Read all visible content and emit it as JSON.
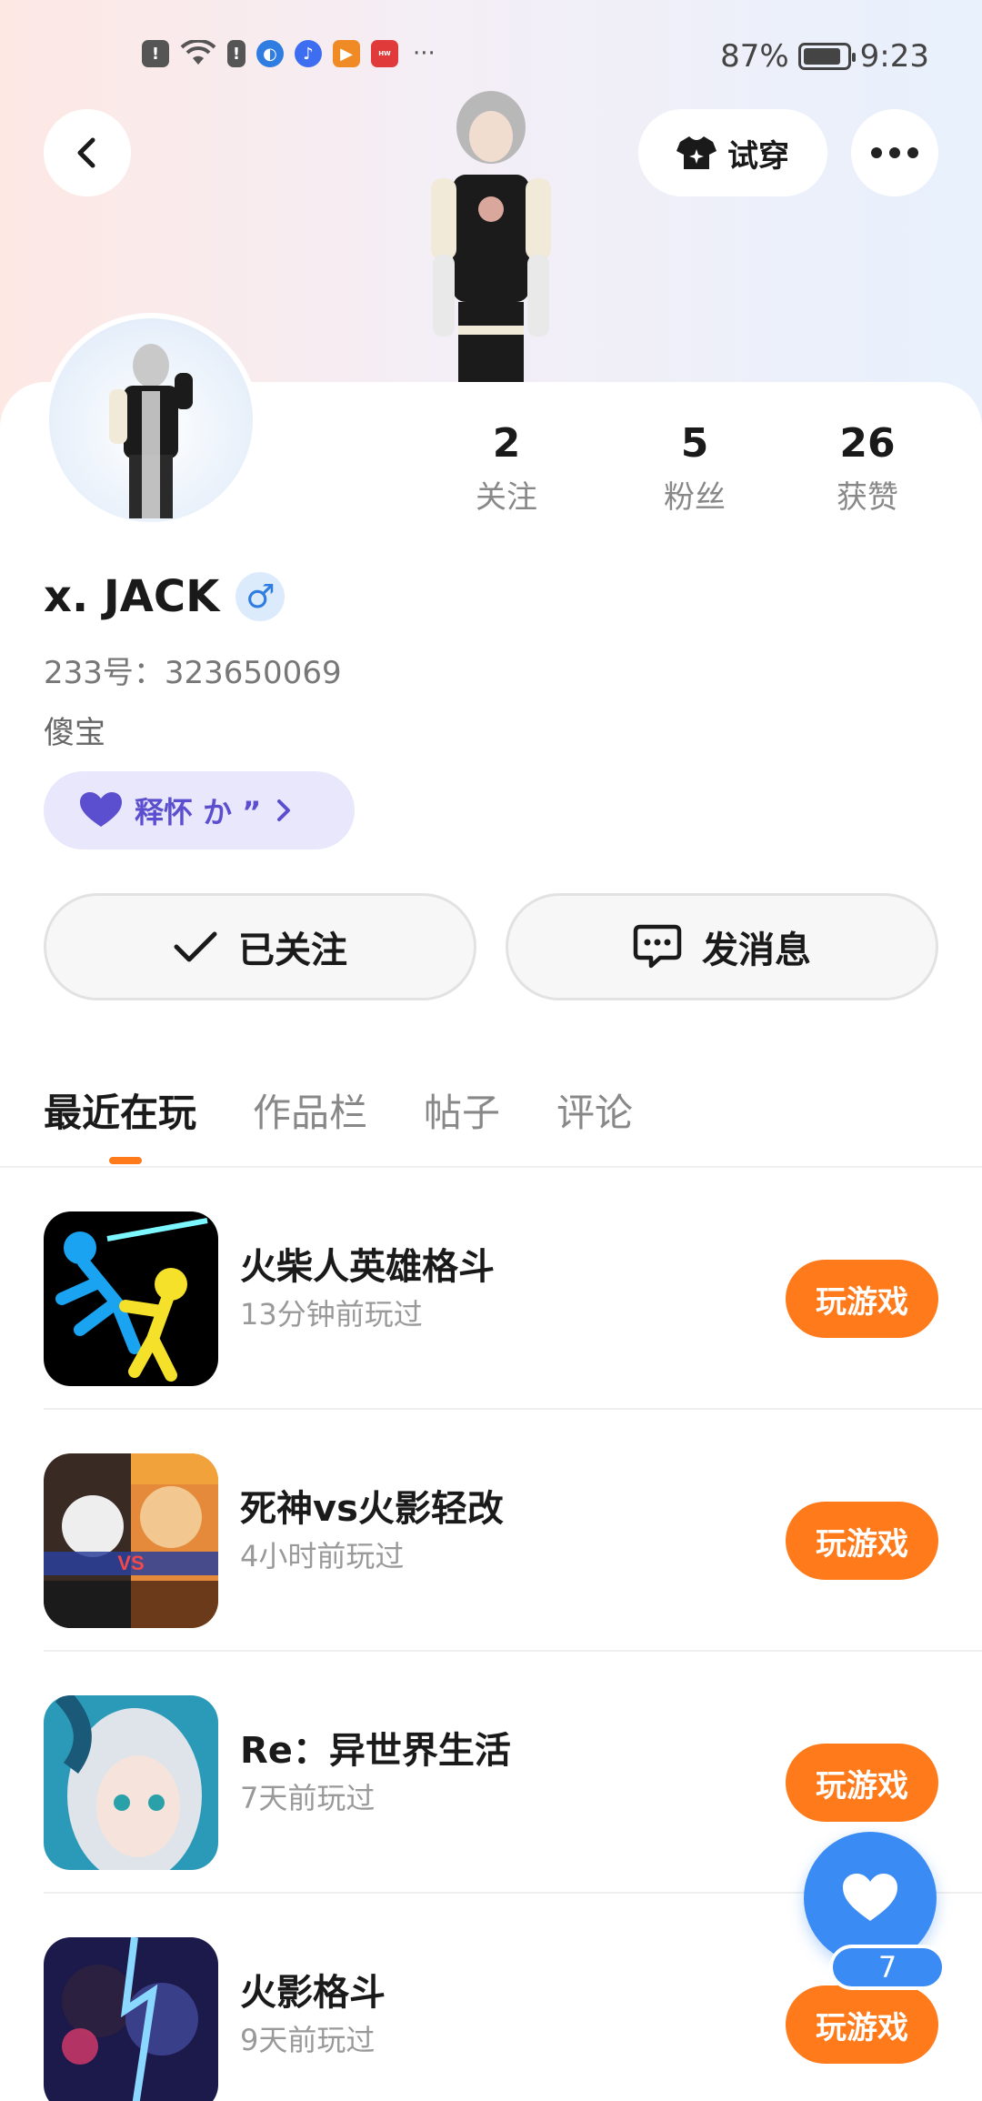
{
  "status_bar": {
    "battery_percent": "87%",
    "battery_level": 0.87,
    "time": "9:23",
    "overflow": "···",
    "notification_icons": [
      "alert-icon",
      "wifi-icon",
      "sim-alert-icon",
      "browser-icon",
      "music-icon",
      "video-icon",
      "huawei-icon"
    ]
  },
  "header": {
    "try_on_label": "试穿"
  },
  "profile": {
    "stats": [
      {
        "value": "2",
        "label": "关注"
      },
      {
        "value": "5",
        "label": "粉丝"
      },
      {
        "value": "26",
        "label": "获赞"
      }
    ],
    "username": "x. JACK",
    "gender_symbol": "♂",
    "user_id": "233号：323650069",
    "bio": "傻宝",
    "fan_tag": "释怀 か ”"
  },
  "actions": {
    "follow_label": "已关注",
    "message_label": "发消息"
  },
  "tabs": [
    "最近在玩",
    "作品栏",
    "帖子",
    "评论"
  ],
  "games": [
    {
      "title": "火柴人英雄格斗",
      "played": "13分钟前玩过",
      "button": "玩游戏"
    },
    {
      "title": "死神vs火影轻改",
      "played": "4小时前玩过",
      "button": "玩游戏"
    },
    {
      "title": "Re：异世界生活",
      "played": "7天前玩过",
      "button": "玩游戏"
    },
    {
      "title": "火影格斗",
      "played": "9天前玩过",
      "button": "玩游戏"
    }
  ],
  "like_fab": {
    "count": "7"
  },
  "colors": {
    "accent_orange": "#ff7a1a",
    "like_blue": "#3b8bf5",
    "fan_tag_purple": "#5b4fcf"
  }
}
